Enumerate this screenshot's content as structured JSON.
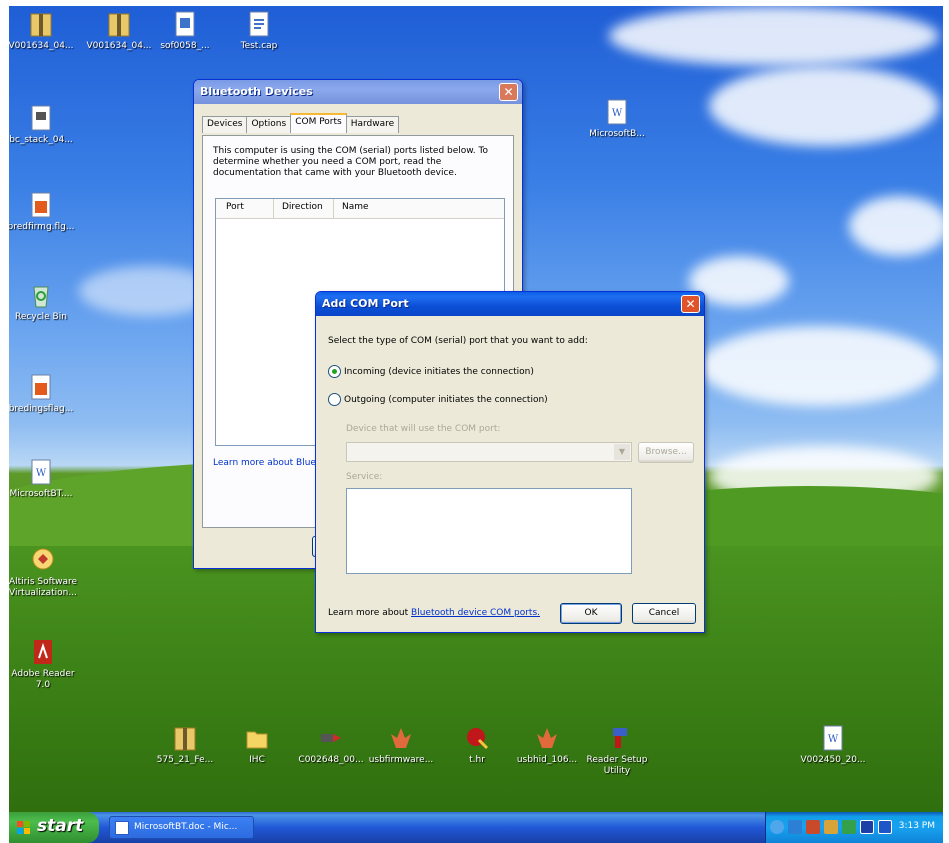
{
  "desktop": {
    "icons": [
      {
        "label": "V001634_04...",
        "kind": "zip"
      },
      {
        "label": "V001634_04...",
        "kind": "zip"
      },
      {
        "label": "sof0058_...",
        "kind": "doc"
      },
      {
        "label": "Test.cap",
        "kind": "file"
      },
      {
        "label": "bc_stack_04...",
        "kind": "doc"
      },
      {
        "label": "bredfirmg.flg...",
        "kind": "app"
      },
      {
        "label": "Recycle Bin",
        "kind": "recycle"
      },
      {
        "label": "bredingsflag...",
        "kind": "app"
      },
      {
        "label": "MicrosoftB...",
        "kind": "word"
      },
      {
        "label": "Altiris Software Virtualization...",
        "kind": "shortcut"
      },
      {
        "label": "Adobe Reader 7.0",
        "kind": "pdf"
      },
      {
        "label": "MicrosoftBT....",
        "kind": "word"
      },
      {
        "label": "575_21_Fe...",
        "kind": "zip"
      },
      {
        "label": "IHC",
        "kind": "folder"
      },
      {
        "label": "C002648_00...",
        "kind": "exe"
      },
      {
        "label": "usbfirmware...",
        "kind": "app"
      },
      {
        "label": "t.hr",
        "kind": "app"
      },
      {
        "label": "usbhid_106...",
        "kind": "app"
      },
      {
        "label": "Reader Setup Utility",
        "kind": "setup"
      },
      {
        "label": "V002450_20...",
        "kind": "word"
      }
    ]
  },
  "bt_window": {
    "title": "Bluetooth Devices",
    "tabs": [
      "Devices",
      "Options",
      "COM Ports",
      "Hardware"
    ],
    "active_tab": "COM Ports",
    "description": "This computer is using the COM (serial) ports listed below. To determine whether you need a COM port, read the documentation that came with your Bluetooth device.",
    "columns": [
      "Port",
      "Direction",
      "Name"
    ],
    "learn_more": "Learn more about Blueto"
  },
  "add_com_dialog": {
    "title": "Add COM Port",
    "prompt": "Select the type of COM (serial) port that you want to add:",
    "incoming_label": "Incoming (device initiates the connection)",
    "outgoing_label": "Outgoing (computer initiates the connection)",
    "selected": "incoming",
    "device_label": "Device that will use the COM port:",
    "browse_label": "Browse...",
    "service_label": "Service:",
    "learn_more_prefix": "Learn more about ",
    "learn_more_link": "Bluetooth device COM ports.",
    "ok_label": "OK",
    "cancel_label": "Cancel"
  },
  "taskbar": {
    "start_label": "start",
    "task_item": "MicrosoftBT.doc - Mic...",
    "clock": "3:13 PM"
  },
  "colors": {
    "title_active": "#0a4fd6",
    "link": "#0033cc",
    "close": "#e0542c"
  }
}
